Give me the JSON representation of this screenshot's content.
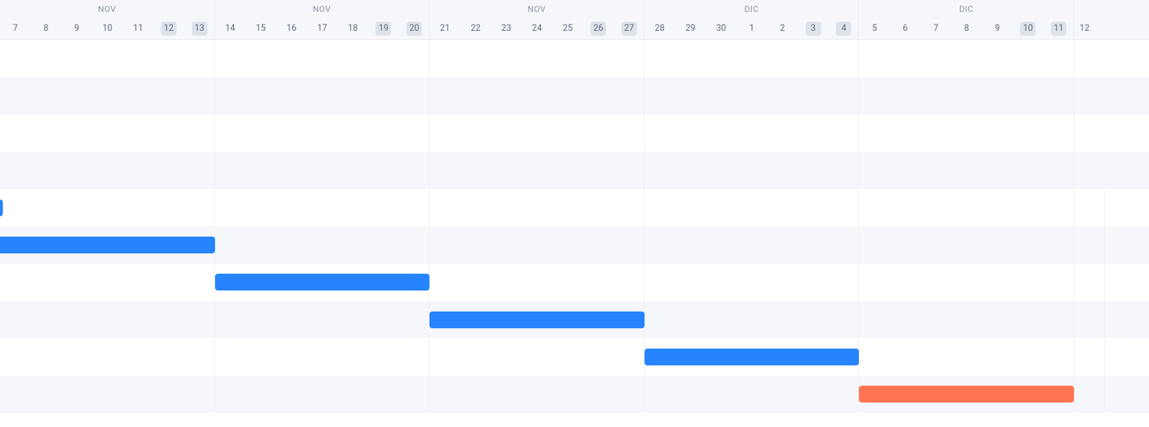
{
  "colors": {
    "blue": "#2684ff",
    "orange": "#ff7452",
    "headerBg": "#f5f7fa"
  },
  "dayWidth": 43.8,
  "weeks": [
    {
      "month": "NOV",
      "days": [
        {
          "d": "7",
          "weekend": false
        },
        {
          "d": "8",
          "weekend": false
        },
        {
          "d": "9",
          "weekend": false
        },
        {
          "d": "10",
          "weekend": false
        },
        {
          "d": "11",
          "weekend": false
        },
        {
          "d": "12",
          "weekend": true
        },
        {
          "d": "13",
          "weekend": true
        }
      ]
    },
    {
      "month": "NOV",
      "days": [
        {
          "d": "14",
          "weekend": false
        },
        {
          "d": "15",
          "weekend": false
        },
        {
          "d": "16",
          "weekend": false
        },
        {
          "d": "17",
          "weekend": false
        },
        {
          "d": "18",
          "weekend": false
        },
        {
          "d": "19",
          "weekend": true
        },
        {
          "d": "20",
          "weekend": true
        }
      ]
    },
    {
      "month": "NOV",
      "days": [
        {
          "d": "21",
          "weekend": false
        },
        {
          "d": "22",
          "weekend": false
        },
        {
          "d": "23",
          "weekend": false
        },
        {
          "d": "24",
          "weekend": false
        },
        {
          "d": "25",
          "weekend": false
        },
        {
          "d": "26",
          "weekend": true
        },
        {
          "d": "27",
          "weekend": true
        }
      ]
    },
    {
      "month": "DIC",
      "days": [
        {
          "d": "28",
          "weekend": false
        },
        {
          "d": "29",
          "weekend": false
        },
        {
          "d": "30",
          "weekend": false
        },
        {
          "d": "1",
          "weekend": false
        },
        {
          "d": "2",
          "weekend": false
        },
        {
          "d": "3",
          "weekend": true
        },
        {
          "d": "4",
          "weekend": true
        }
      ]
    },
    {
      "month": "DIC",
      "days": [
        {
          "d": "5",
          "weekend": false
        },
        {
          "d": "6",
          "weekend": false
        },
        {
          "d": "7",
          "weekend": false
        },
        {
          "d": "8",
          "weekend": false
        },
        {
          "d": "9",
          "weekend": false
        },
        {
          "d": "10",
          "weekend": true
        },
        {
          "d": "11",
          "weekend": true
        }
      ]
    },
    {
      "month": "",
      "days": [
        {
          "d": "12",
          "weekend": false
        }
      ]
    }
  ],
  "rows": [
    {
      "stripe": false,
      "bar": null
    },
    {
      "stripe": true,
      "bar": null
    },
    {
      "stripe": false,
      "bar": null
    },
    {
      "stripe": true,
      "bar": null
    },
    {
      "stripe": false,
      "bar": {
        "startDay": 0,
        "lengthDays": 0.1,
        "color": "blue",
        "radius": "right"
      }
    },
    {
      "stripe": true,
      "bar": {
        "startDay": 0,
        "lengthDays": 7,
        "color": "blue",
        "radius": "right"
      }
    },
    {
      "stripe": false,
      "bar": {
        "startDay": 7,
        "lengthDays": 7,
        "color": "blue",
        "radius": "both"
      }
    },
    {
      "stripe": true,
      "bar": {
        "startDay": 14,
        "lengthDays": 7,
        "color": "blue",
        "radius": "both"
      }
    },
    {
      "stripe": false,
      "bar": {
        "startDay": 21,
        "lengthDays": 7,
        "color": "blue",
        "radius": "both"
      }
    },
    {
      "stripe": true,
      "bar": {
        "startDay": 28,
        "lengthDays": 7,
        "color": "orange",
        "radius": "both"
      }
    }
  ]
}
